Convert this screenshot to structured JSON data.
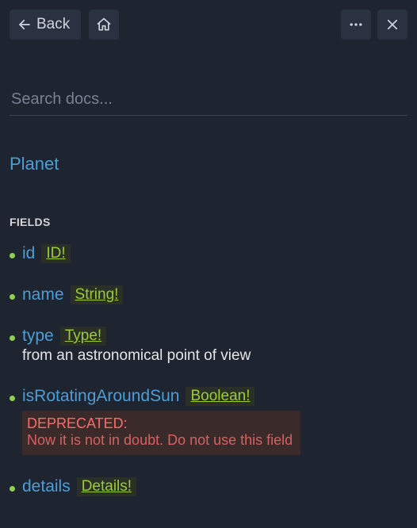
{
  "toolbar": {
    "back_label": "Back"
  },
  "search": {
    "placeholder": "Search docs..."
  },
  "type_name": "Planet",
  "section_label": "FIELDS",
  "fields": [
    {
      "name": "id",
      "type": "ID!",
      "description": null,
      "deprecated": null
    },
    {
      "name": "name",
      "type": "String!",
      "description": null,
      "deprecated": null
    },
    {
      "name": "type",
      "type": "Type!",
      "description": "from an astronomical point of view",
      "deprecated": null
    },
    {
      "name": "isRotatingAroundSun",
      "type": "Boolean!",
      "description": null,
      "deprecated": {
        "label": "DEPRECATED:",
        "reason": "Now it is not in doubt. Do not use this field"
      }
    },
    {
      "name": "details",
      "type": "Details!",
      "description": null,
      "deprecated": null
    }
  ]
}
